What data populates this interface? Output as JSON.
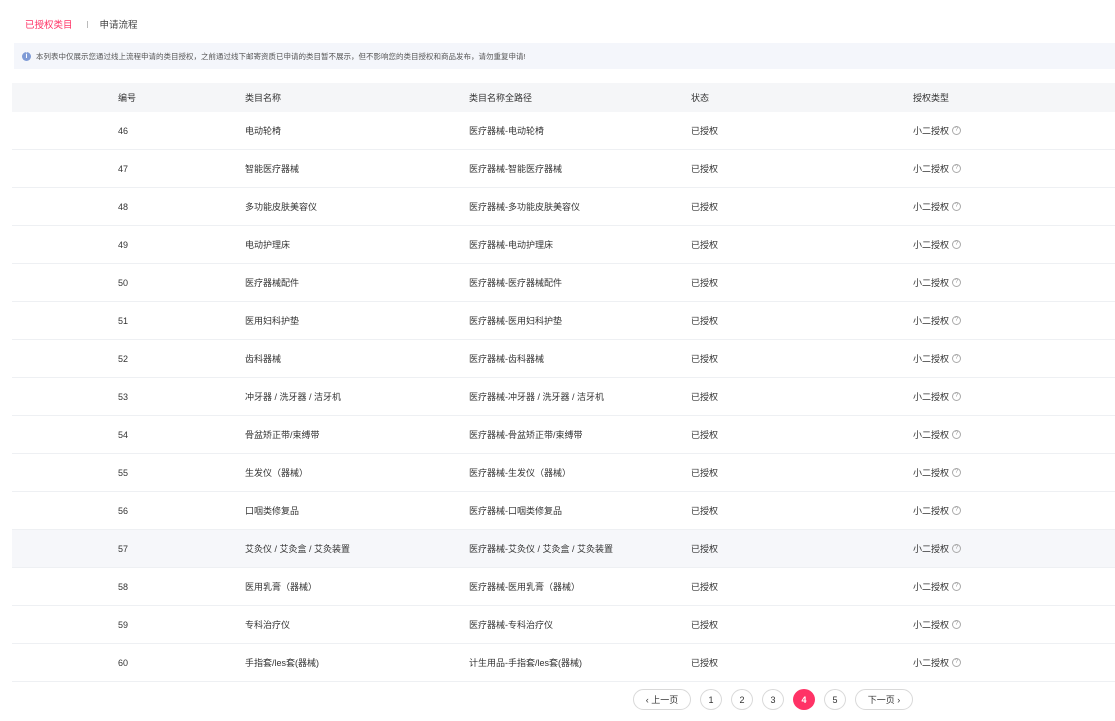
{
  "tabs": [
    {
      "label": "已授权类目",
      "active": true
    },
    {
      "label": "申请流程",
      "active": false
    }
  ],
  "notice": {
    "icon": "info-icon",
    "text": "本列表中仅展示您通过线上流程申请的类目授权，之前通过线下邮寄资质已申请的类目暂不展示，但不影响您的类目授权和商品发布，请勿重复申请!"
  },
  "table": {
    "headers": [
      "编号",
      "类目名称",
      "类目名称全路径",
      "状态",
      "授权类型"
    ],
    "rows": [
      {
        "id": "46",
        "name": "电动轮椅",
        "path": "医疗器械-电动轮椅",
        "status": "已授权",
        "type": "小二授权"
      },
      {
        "id": "47",
        "name": "智能医疗器械",
        "path": "医疗器械-智能医疗器械",
        "status": "已授权",
        "type": "小二授权"
      },
      {
        "id": "48",
        "name": "多功能皮肤美容仪",
        "path": "医疗器械-多功能皮肤美容仪",
        "status": "已授权",
        "type": "小二授权"
      },
      {
        "id": "49",
        "name": "电动护理床",
        "path": "医疗器械-电动护理床",
        "status": "已授权",
        "type": "小二授权"
      },
      {
        "id": "50",
        "name": "医疗器械配件",
        "path": "医疗器械-医疗器械配件",
        "status": "已授权",
        "type": "小二授权"
      },
      {
        "id": "51",
        "name": "医用妇科护垫",
        "path": "医疗器械-医用妇科护垫",
        "status": "已授权",
        "type": "小二授权"
      },
      {
        "id": "52",
        "name": "齿科器械",
        "path": "医疗器械-齿科器械",
        "status": "已授权",
        "type": "小二授权"
      },
      {
        "id": "53",
        "name": "冲牙器 / 洗牙器 / 洁牙机",
        "path": "医疗器械-冲牙器 / 洗牙器 / 洁牙机",
        "status": "已授权",
        "type": "小二授权"
      },
      {
        "id": "54",
        "name": "骨盆矫正带/束缚带",
        "path": "医疗器械-骨盆矫正带/束缚带",
        "status": "已授权",
        "type": "小二授权"
      },
      {
        "id": "55",
        "name": "生发仪（器械）",
        "path": "医疗器械-生发仪（器械）",
        "status": "已授权",
        "type": "小二授权"
      },
      {
        "id": "56",
        "name": "口咽类修复品",
        "path": "医疗器械-口咽类修复品",
        "status": "已授权",
        "type": "小二授权"
      },
      {
        "id": "57",
        "name": "艾灸仪 / 艾灸盒 / 艾灸装置",
        "path": "医疗器械-艾灸仪 / 艾灸盒 / 艾灸装置",
        "status": "已授权",
        "type": "小二授权",
        "highlighted": true
      },
      {
        "id": "58",
        "name": "医用乳膏（器械）",
        "path": "医疗器械-医用乳膏（器械）",
        "status": "已授权",
        "type": "小二授权"
      },
      {
        "id": "59",
        "name": "专科治疗仪",
        "path": "医疗器械-专科治疗仪",
        "status": "已授权",
        "type": "小二授权"
      },
      {
        "id": "60",
        "name": "手指套/les套(器械)",
        "path": "计生用品-手指套/les套(器械)",
        "status": "已授权",
        "type": "小二授权"
      }
    ],
    "type_help_icon": "question-circle-icon"
  },
  "pagination": {
    "prev_label": "上一页",
    "next_label": "下一页",
    "pages": [
      "1",
      "2",
      "3",
      "4",
      "5"
    ],
    "current": "4"
  },
  "colors": {
    "accent": "#ff3366",
    "header_bg": "#f5f6f8",
    "notice_bg": "#f4f6fb",
    "info_icon": "#7f9bd6"
  }
}
